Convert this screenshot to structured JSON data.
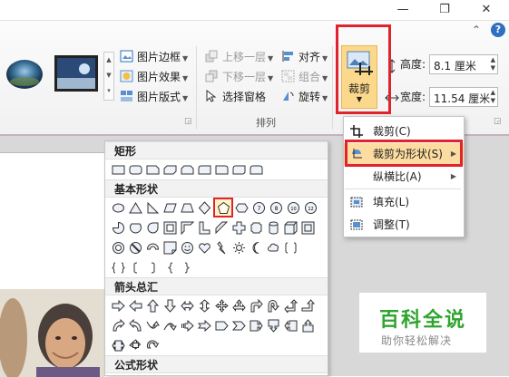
{
  "window": {
    "minimize": "—",
    "restore": "❐",
    "close": "✕",
    "collapse_ribbon": "⌃",
    "help": "?"
  },
  "ribbon": {
    "picture_styles": {
      "border_label": "图片边框",
      "effects_label": "图片效果",
      "layout_label": "图片版式"
    },
    "arrange": {
      "bring_forward": "上移一层",
      "send_backward": "下移一层",
      "selection_pane": "选择窗格",
      "align": "对齐",
      "group": "组合",
      "rotate": "旋转",
      "group_label": "排列"
    },
    "crop_button_label": "裁剪",
    "size": {
      "height_label": "高度:",
      "height_value": "8.1 厘米",
      "width_label": "宽度:",
      "width_value": "11.54 厘米"
    }
  },
  "crop_menu": {
    "items": [
      {
        "label": "裁剪(C)"
      },
      {
        "label": "裁剪为形状(S)"
      },
      {
        "label": "纵横比(A)"
      },
      {
        "label": "填充(L)"
      },
      {
        "label": "调整(T)"
      }
    ]
  },
  "shapes_gallery": {
    "sections": [
      "矩形",
      "基本形状",
      "箭头总汇",
      "公式形状"
    ]
  },
  "watermark": {
    "title": "百科全说",
    "subtitle": "助你轻松解决"
  },
  "colors": {
    "highlight_red": "#e0232f",
    "menu_highlight": "#fcdca0",
    "watermark_green": "#2fa52f"
  }
}
